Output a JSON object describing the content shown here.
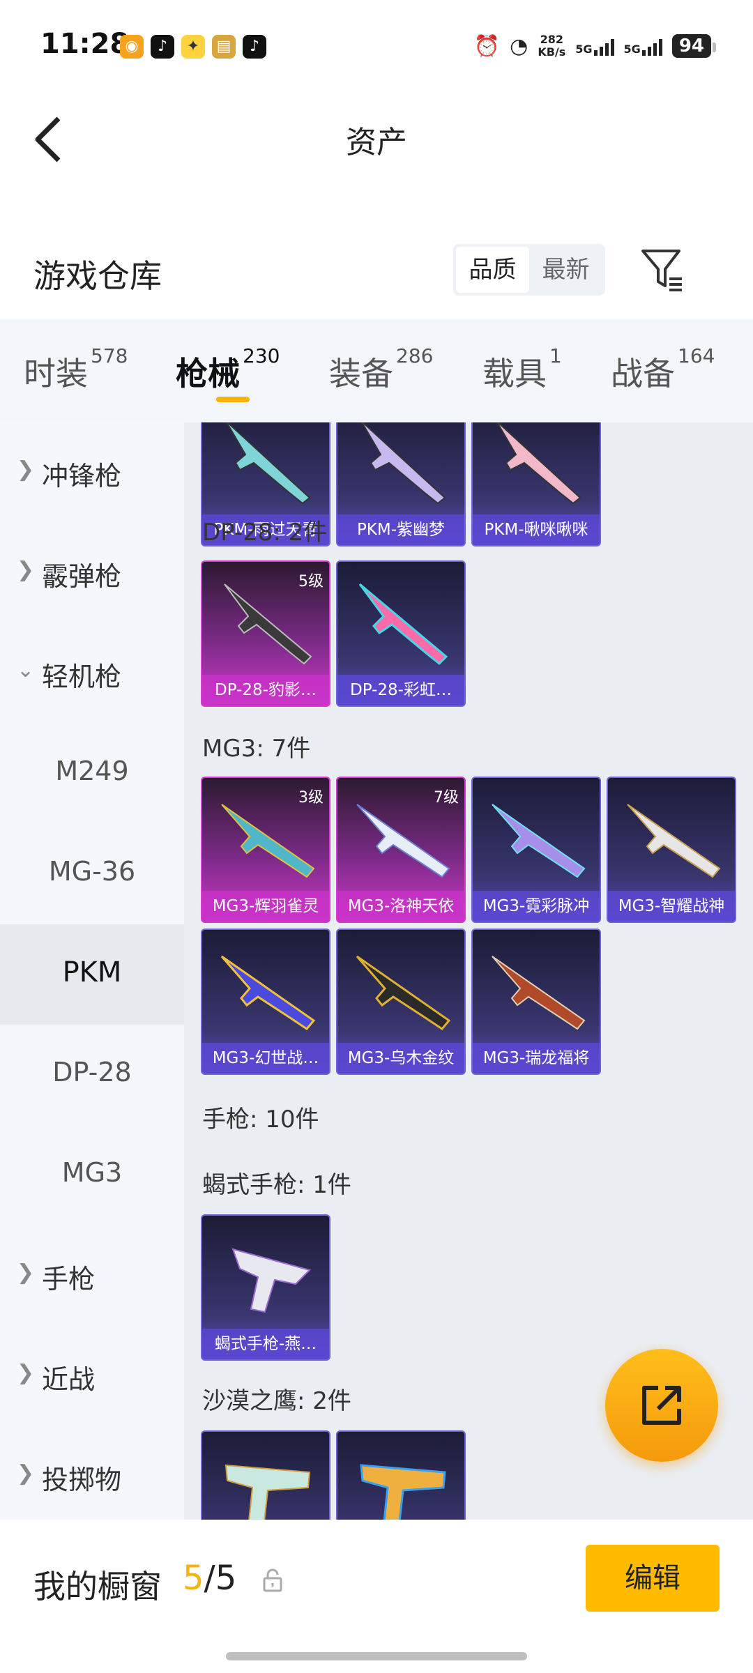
{
  "status": {
    "time": "11:28",
    "apps": [
      "weibo-icon",
      "tiktok-icon",
      "qq-icon",
      "news-icon",
      "tiktok-icon"
    ],
    "speed_value": "282",
    "speed_unit": "KB/s",
    "net1": "5G",
    "net2": "5G",
    "battery": "94"
  },
  "header": {
    "title": "资产"
  },
  "section": {
    "title": "游戏仓库",
    "sort_quality": "品质",
    "sort_latest": "最新"
  },
  "tabs": [
    {
      "label": "时装",
      "count": "578"
    },
    {
      "label": "枪械",
      "count": "230"
    },
    {
      "label": "装备",
      "count": "286"
    },
    {
      "label": "载具",
      "count": "1"
    },
    {
      "label": "战备",
      "count": "164"
    }
  ],
  "sidebar": [
    {
      "label": "冲锋枪"
    },
    {
      "label": "霰弹枪"
    },
    {
      "label": "轻机枪"
    },
    {
      "label": "M249"
    },
    {
      "label": "MG-36"
    },
    {
      "label": "PKM"
    },
    {
      "label": "DP-28"
    },
    {
      "label": "MG3"
    },
    {
      "label": "手枪"
    },
    {
      "label": "近战"
    },
    {
      "label": "投掷物"
    }
  ],
  "content": {
    "pkm_cards": [
      "PKM-雨过天青",
      "PKM-紫幽梦",
      "PKM-啾咪啾咪"
    ],
    "dp28_title": "DP-28: 2件",
    "dp28_cards": [
      {
        "name": "DP-28-豹影…",
        "level": "5级"
      },
      {
        "name": "DP-28-彩虹…",
        "level": ""
      }
    ],
    "mg3_title": "MG3: 7件",
    "mg3_cards": [
      {
        "name": "MG3-辉羽雀灵",
        "level": "3级"
      },
      {
        "name": "MG3-洛神天依",
        "level": "7级"
      },
      {
        "name": "MG3-霓彩脉冲",
        "level": ""
      },
      {
        "name": "MG3-智耀战神",
        "level": ""
      },
      {
        "name": "MG3-幻世战…",
        "level": ""
      },
      {
        "name": "MG3-乌木金纹",
        "level": ""
      },
      {
        "name": "MG3-瑞龙福将",
        "level": ""
      }
    ],
    "pistol_title": "手枪: 10件",
    "scorpion_title": "蝎式手枪: 1件",
    "scorpion_cards": [
      "蝎式手枪-燕…"
    ],
    "deagle_title": "沙漠之鹰: 2件"
  },
  "bottom": {
    "label": "我的橱窗",
    "current": "5",
    "sep": "/",
    "total": "5",
    "edit": "编辑"
  }
}
